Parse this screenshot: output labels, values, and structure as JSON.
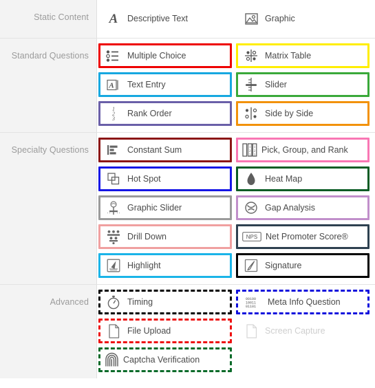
{
  "sections": [
    {
      "label": "Static Content",
      "items": [
        {
          "label": "Descriptive Text",
          "icon": "serif-a-icon",
          "border": "none"
        },
        {
          "label": "Graphic",
          "icon": "image-icon",
          "border": "none"
        }
      ]
    },
    {
      "label": "Standard Questions",
      "items": [
        {
          "label": "Multiple Choice",
          "icon": "multiple-choice-icon",
          "border": "#ee0000",
          "style": "solid"
        },
        {
          "label": "Matrix Table",
          "icon": "matrix-table-icon",
          "border": "#ffee00",
          "style": "solid"
        },
        {
          "label": "Text Entry",
          "icon": "text-entry-icon",
          "border": "#17a8e0",
          "style": "solid"
        },
        {
          "label": "Slider",
          "icon": "slider-icon",
          "border": "#3aa93a",
          "style": "solid"
        },
        {
          "label": "Rank Order",
          "icon": "rank-order-icon",
          "border": "#6a5fa8",
          "style": "solid"
        },
        {
          "label": "Side by Side",
          "icon": "side-by-side-icon",
          "border": "#f2920b",
          "style": "solid"
        }
      ]
    },
    {
      "label": "Specialty Questions",
      "items": [
        {
          "label": "Constant Sum",
          "icon": "constant-sum-icon",
          "border": "#8c1616",
          "style": "solid"
        },
        {
          "label": "Pick, Group, and Rank",
          "icon": "pick-group-rank-icon",
          "border": "#f977b4",
          "style": "solid"
        },
        {
          "label": "Hot Spot",
          "icon": "hot-spot-icon",
          "border": "#1616e6",
          "style": "solid"
        },
        {
          "label": "Heat Map",
          "icon": "heat-map-icon",
          "border": "#0a5c25",
          "style": "solid"
        },
        {
          "label": "Graphic Slider",
          "icon": "graphic-slider-icon",
          "border": "#9b9b9b",
          "style": "solid"
        },
        {
          "label": "Gap Analysis",
          "icon": "gap-analysis-icon",
          "border": "#c18fcb",
          "style": "solid"
        },
        {
          "label": "Drill Down",
          "icon": "drill-down-icon",
          "border": "#f0a0a0",
          "style": "solid"
        },
        {
          "label": "Net Promoter Score®",
          "icon": "nps-icon",
          "border": "#2e4150",
          "style": "solid"
        },
        {
          "label": "Highlight",
          "icon": "highlight-icon",
          "border": "#1ab4e8",
          "style": "solid"
        },
        {
          "label": "Signature",
          "icon": "signature-icon",
          "border": "#000000",
          "style": "solid"
        }
      ]
    },
    {
      "label": "Advanced",
      "items": [
        {
          "label": "Timing",
          "icon": "timing-icon",
          "border": "#000000",
          "style": "dashed"
        },
        {
          "label": "Meta Info Question",
          "icon": "meta-info-icon",
          "border": "#1010dd",
          "style": "dashed"
        },
        {
          "label": "File Upload",
          "icon": "file-upload-icon",
          "border": "#ee1111",
          "style": "dashed"
        },
        {
          "label": "Screen Capture",
          "icon": "screen-capture-icon",
          "border": "none",
          "disabled": true
        },
        {
          "label": "Captcha Verification",
          "icon": "captcha-icon",
          "border": "#0a6b2a",
          "style": "dashed"
        }
      ]
    }
  ],
  "colors": {
    "label_text": "#9b9b9b",
    "tile_text": "#4a4a4a",
    "sidebar_bg": "#f3f3f3",
    "divider": "#e0e0e0",
    "disabled_text": "#cfcfcf"
  }
}
